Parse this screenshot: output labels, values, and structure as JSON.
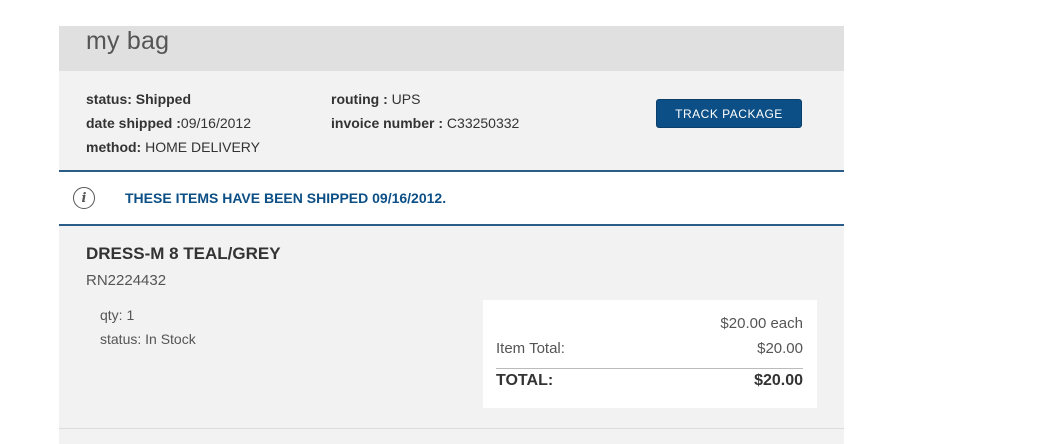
{
  "bag": {
    "title": "my bag"
  },
  "order": {
    "status_label": "status:",
    "status_value": "Shipped",
    "date_label": "date shipped :",
    "date_value": "09/16/2012",
    "method_label": "method:",
    "method_value": "HOME DELIVERY",
    "routing_label": "routing :",
    "routing_value": "UPS",
    "invoice_label": "invoice number :",
    "invoice_value": "C33250332",
    "track_button": "TRACK PACKAGE"
  },
  "notice": {
    "icon": "info-icon",
    "text": "THESE ITEMS HAVE BEEN SHIPPED 09/16/2012."
  },
  "item": {
    "name": "DRESS-M 8 TEAL/GREY",
    "sku": "RN2224432",
    "qty": "qty: 1",
    "status": "status: In Stock",
    "each_price": "$20.00 each",
    "item_total_label": "Item Total:",
    "item_total_value": "$20.00",
    "total_label": "TOTAL:",
    "total_value": "$20.00"
  }
}
